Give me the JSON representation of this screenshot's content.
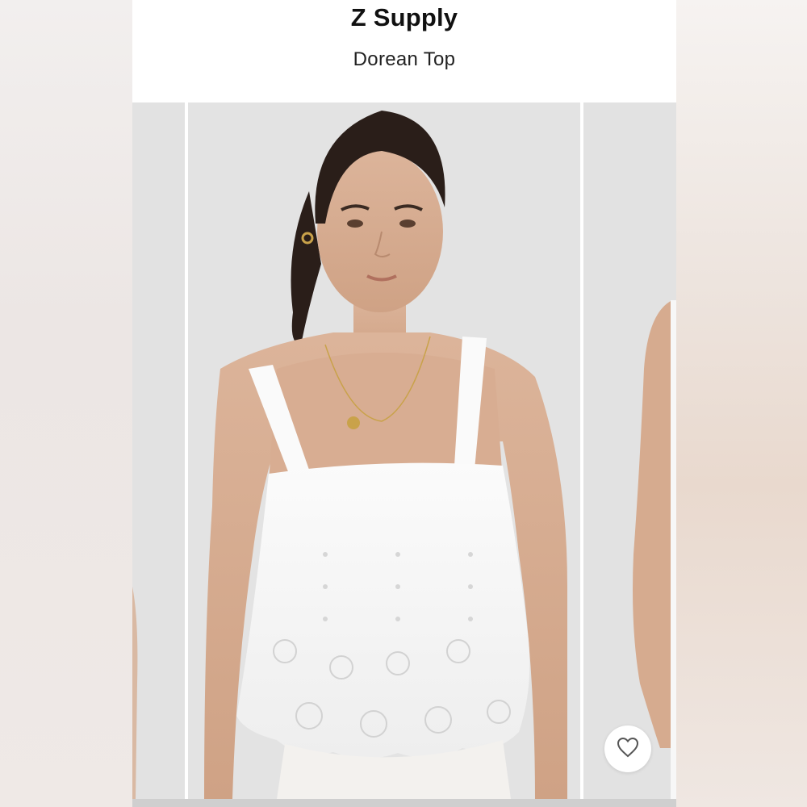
{
  "header": {
    "brand": "Z Supply",
    "product_name": "Dorean Top"
  },
  "gallery": {
    "images": [
      {
        "name": "previous-product-photo"
      },
      {
        "name": "main-product-photo"
      },
      {
        "name": "next-product-photo"
      }
    ]
  },
  "actions": {
    "like_icon": "heart-outline-icon"
  },
  "colors": {
    "photo_background": "#e2e2e2",
    "text": "#111111",
    "page_background": "#ffffff"
  }
}
